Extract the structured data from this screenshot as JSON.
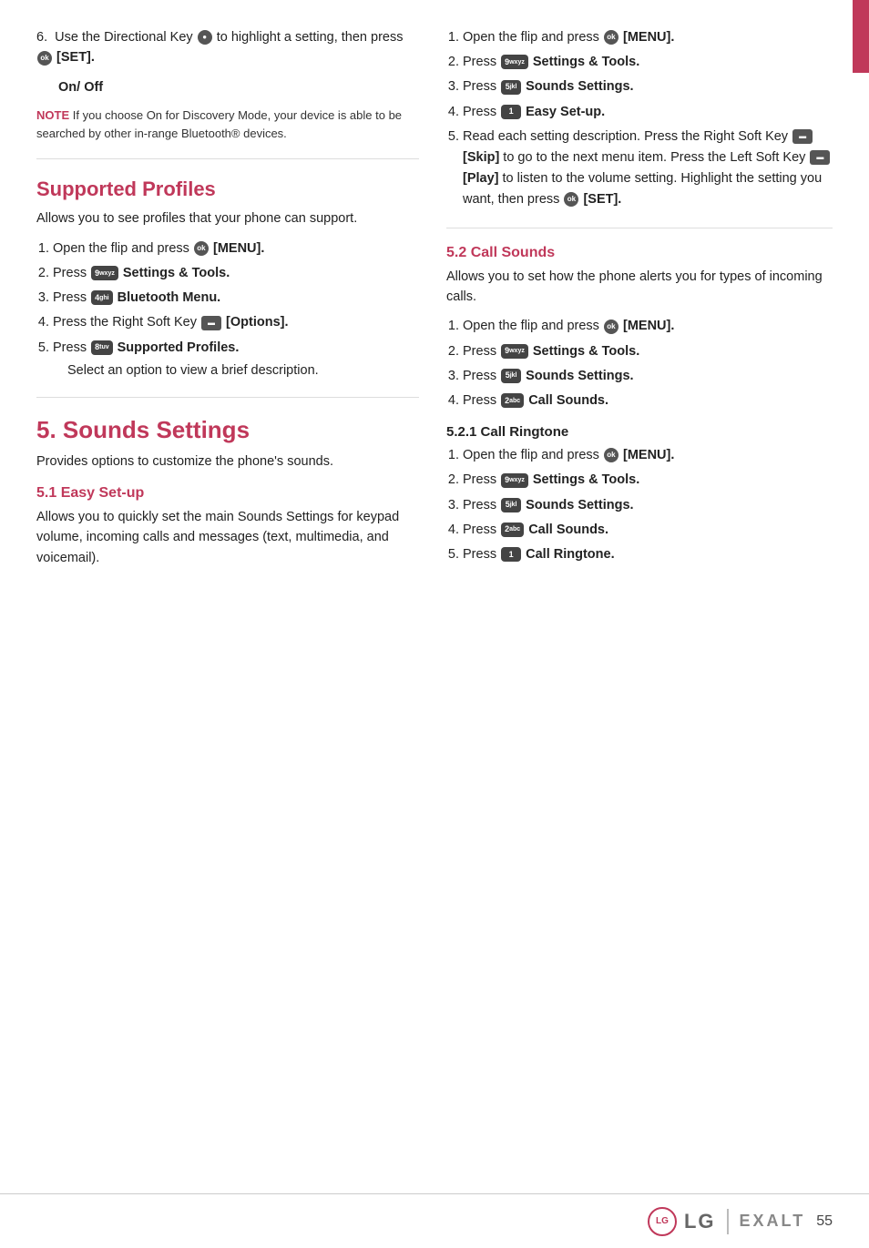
{
  "page": {
    "number": "55"
  },
  "top_tab": {
    "color": "#c0385a"
  },
  "left_column": {
    "intro_step6": "6.  Use the Directional Key",
    "intro_step6_cont": "to highlight a setting, then press",
    "intro_step6_set": "[SET].",
    "intro_onoff": "On/ Off",
    "note_label": "NOTE",
    "note_text": "If you choose On for Discovery Mode, your device is able to be searched by other in-range Bluetooth® devices.",
    "supported_profiles_heading": "Supported Profiles",
    "supported_profiles_body": "Allows you to see profiles that your phone can support.",
    "supported_profiles_steps": [
      {
        "id": 1,
        "text": "Open the flip and press",
        "key": "ok",
        "bold": "[MENU]."
      },
      {
        "id": 2,
        "text": "Press",
        "key": "9",
        "bold": "Settings & Tools."
      },
      {
        "id": 3,
        "text": "Press",
        "key": "4",
        "bold": "Bluetooth Menu."
      },
      {
        "id": 4,
        "text": "Press the Right Soft Key",
        "key": "soft-r",
        "bold": "[Options]."
      },
      {
        "id": 5,
        "text": "Press",
        "key": "8",
        "bold": "Supported Profiles.",
        "extra": "Select an option to view a brief description."
      }
    ],
    "sounds_settings_heading": "5. Sounds Settings",
    "sounds_settings_body": "Provides options to customize the phone's sounds.",
    "easy_setup_heading": "5.1 Easy Set-up",
    "easy_setup_body": "Allows you to quickly set the main Sounds Settings for keypad volume, incoming calls and messages (text, multimedia, and voicemail)."
  },
  "right_column": {
    "easy_setup_steps": [
      {
        "id": 1,
        "text": "Open the flip and press",
        "key": "ok",
        "bold": "[MENU]."
      },
      {
        "id": 2,
        "text": "Press",
        "key": "9",
        "bold": "Settings & Tools."
      },
      {
        "id": 3,
        "text": "Press",
        "key": "5",
        "bold": "Sounds Settings."
      },
      {
        "id": 4,
        "text": "Press",
        "key": "1",
        "bold": "Easy Set-up."
      },
      {
        "id": 5,
        "text": "Read each setting description. Press the Right Soft Key",
        "key": "soft-r",
        "bold": "[Skip]",
        "extra": "to go to the next menu item. Press the Left Soft Key",
        "key2": "soft-l",
        "bold2": "[Play]",
        "extra2": "to listen to the volume setting. Highlight the setting you want, then press",
        "key3": "ok",
        "bold3": "[SET]."
      }
    ],
    "call_sounds_heading": "5.2 Call Sounds",
    "call_sounds_body": "Allows you to set how the phone alerts you for types of incoming calls.",
    "call_sounds_steps": [
      {
        "id": 1,
        "text": "Open the flip and press",
        "key": "ok",
        "bold": "[MENU]."
      },
      {
        "id": 2,
        "text": "Press",
        "key": "9",
        "bold": "Settings & Tools."
      },
      {
        "id": 3,
        "text": "Press",
        "key": "5",
        "bold": "Sounds Settings."
      },
      {
        "id": 4,
        "text": "Press",
        "key": "2",
        "bold": "Call Sounds."
      }
    ],
    "call_ringtone_heading": "5.2.1 Call Ringtone",
    "call_ringtone_steps": [
      {
        "id": 1,
        "text": "Open the flip and press",
        "key": "ok",
        "bold": "[MENU]."
      },
      {
        "id": 2,
        "text": "Press",
        "key": "9",
        "bold": "Settings & Tools."
      },
      {
        "id": 3,
        "text": "Press",
        "key": "5",
        "bold": "Sounds Settings."
      },
      {
        "id": 4,
        "text": "Press",
        "key": "2",
        "bold": "Call Sounds."
      },
      {
        "id": 5,
        "text": "Press",
        "key": "1",
        "bold": "Call Ringtone."
      }
    ]
  },
  "footer": {
    "brand": "LG",
    "model": "EXALT",
    "page": "55"
  },
  "key_labels": {
    "ok": "ok",
    "9": "9wxyz",
    "5": "5jkl",
    "4": "4ghi",
    "8": "8tuv",
    "1": "1",
    "2": "2abc",
    "soft-r": "▬",
    "soft-l": "▬"
  }
}
